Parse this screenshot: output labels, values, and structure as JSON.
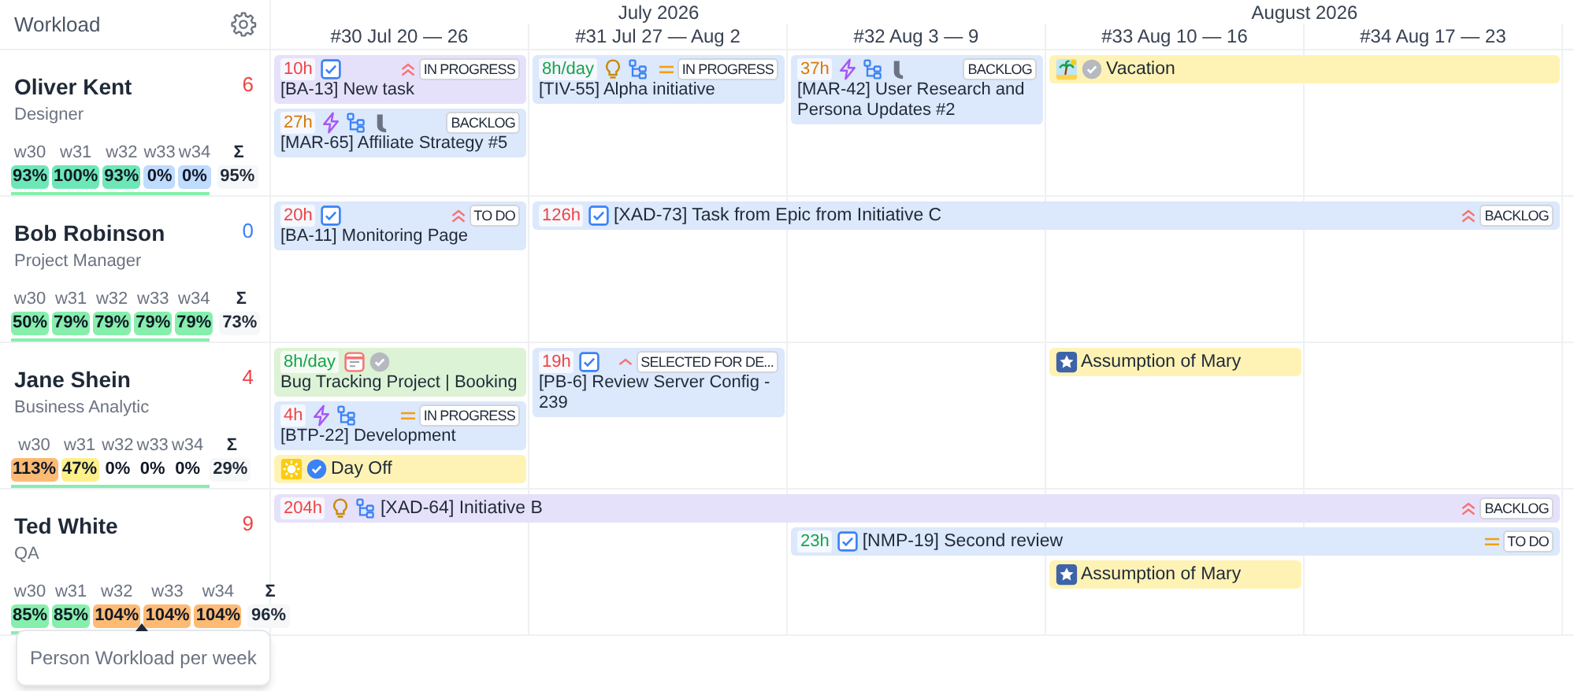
{
  "panel": {
    "title": "Workload"
  },
  "months": [
    {
      "label": "July 2026",
      "weeks": [
        "#30 Jul 20 — 26",
        "#31 Jul 27 — Aug 2",
        "#32 Aug 3 — 9"
      ]
    },
    {
      "label": "August 2026",
      "weeks": [
        "#33 Aug 10 — 16",
        "#34 Aug 17 — 23"
      ]
    }
  ],
  "people": [
    {
      "name": "Oliver Kent",
      "role": "Designer",
      "count": {
        "text": "6",
        "color": "#ef4444"
      },
      "total_label": "Σ",
      "total": "95%",
      "weeks": [
        {
          "label": "w30",
          "value": "93%",
          "color": "#6ee7b7"
        },
        {
          "label": "w31",
          "value": "100%",
          "color": "#6ee7b7"
        },
        {
          "label": "w32",
          "value": "93%",
          "color": "#6ee7b7"
        },
        {
          "label": "w33",
          "value": "0%",
          "color": "#bfdbfe"
        },
        {
          "label": "w34",
          "value": "0%",
          "color": "#bfdbfe"
        }
      ],
      "lanes": [
        [
          {
            "kind": "task",
            "color": "#e6e1fb",
            "hours": {
              "text": "10h",
              "color": "#ef4444"
            },
            "icons": [
              {
                "kind": "checkbox"
              }
            ],
            "text": "[BA-13] New task",
            "priority": {
              "kind": "highest"
            },
            "status": "IN PROGRESS"
          },
          {
            "kind": "task",
            "color": "#dce8fb",
            "hours": {
              "text": "8h/day",
              "color": "#16a34a"
            },
            "icons": [
              {
                "kind": "bulb"
              },
              {
                "kind": "hierarchy"
              }
            ],
            "text": "[TIV-55] Alpha initiative",
            "priority": {
              "kind": "medium"
            },
            "status": "IN PROGRESS"
          },
          {
            "kind": "task",
            "color": "#dce8fb",
            "hours": {
              "text": "37h",
              "color": "#d97706"
            },
            "icons": [
              {
                "kind": "epic"
              },
              {
                "kind": "hierarchy"
              },
              {
                "kind": "hook"
              }
            ],
            "text": "[MAR-42] User Research and Persona Updates #2",
            "status": "BACKLOG"
          },
          {
            "kind": "absence",
            "color": "#fef3b5",
            "icons": [
              {
                "kind": "palm"
              },
              {
                "kind": "check-grey"
              }
            ],
            "text": "Vacation"
          },
          {
            "kind": "continued"
          }
        ],
        [
          {
            "kind": "task",
            "color": "#dce8fb",
            "hours": {
              "text": "27h",
              "color": "#d97706"
            },
            "icons": [
              {
                "kind": "epic"
              },
              {
                "kind": "hierarchy"
              },
              {
                "kind": "hook"
              }
            ],
            "text": "[MAR-65] Affiliate Strategy #5",
            "status": "BACKLOG"
          }
        ]
      ]
    },
    {
      "name": "Bob Robinson",
      "role": "Project Manager",
      "count": {
        "text": "0",
        "color": "#3b82f6"
      },
      "total_label": "Σ",
      "total": "73%",
      "weeks": [
        {
          "label": "w30",
          "value": "50%",
          "color": "#86efac"
        },
        {
          "label": "w31",
          "value": "79%",
          "color": "#86efac"
        },
        {
          "label": "w32",
          "value": "79%",
          "color": "#86efac"
        },
        {
          "label": "w33",
          "value": "79%",
          "color": "#86efac"
        },
        {
          "label": "w34",
          "value": "79%",
          "color": "#86efac"
        }
      ],
      "lanes": [
        [
          {
            "kind": "task",
            "color": "#dce8fb",
            "hours": {
              "text": "20h",
              "color": "#ef4444"
            },
            "icons": [
              {
                "kind": "checkbox"
              }
            ],
            "text": "[BA-11] Monitoring Page",
            "priority": {
              "kind": "highest"
            },
            "status": "TO DO"
          },
          {
            "kind": "task",
            "color": "#dce8fb",
            "hours": {
              "text": "126h",
              "color": "#ef4444"
            },
            "icons": [
              {
                "kind": "checkbox"
              }
            ],
            "text": "[XAD-73] Task from Epic from Initiative C",
            "priority": {
              "kind": "highest"
            },
            "status": "BACKLOG"
          },
          {
            "kind": "continued"
          },
          {
            "kind": "continued"
          },
          {
            "kind": "continued"
          }
        ]
      ]
    },
    {
      "name": "Jane Shein",
      "role": "Business Analytic",
      "count": {
        "text": "4",
        "color": "#ef4444"
      },
      "total_label": "Σ",
      "total": "29%",
      "weeks": [
        {
          "label": "w30",
          "value": "113%",
          "color": "#fdba74"
        },
        {
          "label": "w31",
          "value": "47%",
          "color": "#fef08a"
        },
        {
          "label": "w32",
          "value": "0%"
        },
        {
          "label": "w33",
          "value": "0%"
        },
        {
          "label": "w34",
          "value": "0%"
        }
      ],
      "lanes": [
        [
          {
            "kind": "task",
            "color": "#dcf3d5",
            "hours": {
              "text": "8h/day",
              "color": "#16a34a"
            },
            "icons": [
              {
                "kind": "calendar"
              },
              {
                "kind": "check-grey"
              }
            ],
            "text": "Bug Tracking Project | Booking"
          },
          {
            "kind": "task",
            "color": "#dce8fb",
            "hours": {
              "text": "19h",
              "color": "#ef4444"
            },
            "icons": [
              {
                "kind": "checkbox"
              }
            ],
            "text": "[PB-6] Review Server Config - 239",
            "priority": {
              "kind": "high"
            },
            "status": "SELECTED FOR DE..."
          },
          {
            "kind": "empty"
          },
          {
            "kind": "absence",
            "color": "#fef3b5",
            "icons": [
              {
                "kind": "star"
              }
            ],
            "text": "Assumption of Mary"
          }
        ],
        [
          {
            "kind": "task",
            "color": "#dce8fb",
            "hours": {
              "text": "4h",
              "color": "#ef4444"
            },
            "icons": [
              {
                "kind": "epic"
              },
              {
                "kind": "hierarchy"
              }
            ],
            "text": "[BTP-22] Development",
            "priority": {
              "kind": "medium"
            },
            "status": "IN PROGRESS"
          }
        ],
        [
          {
            "kind": "absence",
            "color": "#fef3b5",
            "icons": [
              {
                "kind": "sun"
              },
              {
                "kind": "check-blue"
              }
            ],
            "text": "Day Off"
          }
        ]
      ]
    },
    {
      "name": "Ted White",
      "role": "QA",
      "count": {
        "text": "9",
        "color": "#ef4444"
      },
      "total_label": "Σ",
      "total": "96%",
      "weeks": [
        {
          "label": "w30",
          "value": "85%",
          "color": "#86efac"
        },
        {
          "label": "w31",
          "value": "85%",
          "color": "#86efac"
        },
        {
          "label": "w32",
          "value": "104%",
          "color": "#fdba74"
        },
        {
          "label": "w33",
          "value": "104%",
          "color": "#fdba74"
        },
        {
          "label": "w34",
          "value": "104%",
          "color": "#fdba74"
        }
      ],
      "lanes": [
        [
          {
            "kind": "task",
            "color": "#e6e1fb",
            "hours": {
              "text": "204h",
              "color": "#ef4444"
            },
            "icons": [
              {
                "kind": "bulb"
              },
              {
                "kind": "hierarchy"
              }
            ],
            "text": "[XAD-64] Initiative B",
            "priority": {
              "kind": "highest"
            },
            "status": "BACKLOG"
          },
          {
            "kind": "continued"
          },
          {
            "kind": "continued"
          },
          {
            "kind": "continued"
          },
          {
            "kind": "continued"
          }
        ],
        [
          {
            "kind": "empty"
          },
          {
            "kind": "empty"
          },
          {
            "kind": "task",
            "color": "#dce8fb",
            "hours": {
              "text": "23h",
              "color": "#16a34a"
            },
            "icons": [
              {
                "kind": "checkbox"
              }
            ],
            "text": "[NMP-19] Second review",
            "priority": {
              "kind": "medium"
            },
            "status": "TO DO"
          },
          {
            "kind": "continued"
          },
          {
            "kind": "continued"
          }
        ],
        [
          {
            "kind": "empty"
          },
          {
            "kind": "empty"
          },
          {
            "kind": "empty"
          },
          {
            "kind": "absence",
            "color": "#fef3b5",
            "icons": [
              {
                "kind": "star"
              }
            ],
            "text": "Assumption of Mary"
          }
        ]
      ]
    }
  ],
  "tooltip": {
    "text": "Person Workload per week"
  }
}
